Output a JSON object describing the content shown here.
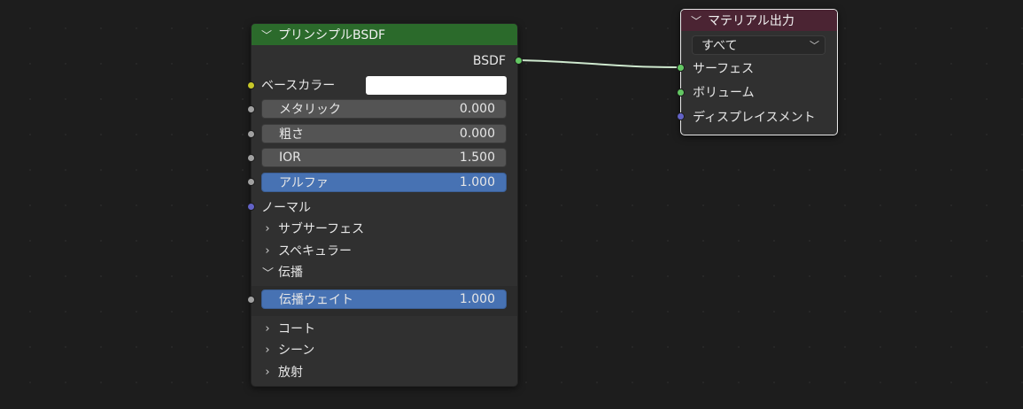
{
  "bsdf_node": {
    "title": "プリンシプルBSDF",
    "output_socket": "BSDF",
    "base_color_label": "ベースカラー",
    "base_color_value": "#ffffff",
    "fields": [
      {
        "label": "メタリック",
        "value": "0.000"
      },
      {
        "label": "粗さ",
        "value": "0.000"
      },
      {
        "label": "IOR",
        "value": "1.500"
      },
      {
        "label": "アルファ",
        "value": "1.000"
      }
    ],
    "normal_label": "ノーマル",
    "panels": {
      "subsurface": "サブサーフェス",
      "specular": "スペキュラー",
      "transmission": "伝播",
      "coat": "コート",
      "sheen": "シーン",
      "emission": "放射"
    },
    "transmission_weight": {
      "label": "伝播ウェイト",
      "value": "1.000"
    }
  },
  "output_node": {
    "title": "マテリアル出力",
    "target": "すべて",
    "inputs": [
      "サーフェス",
      "ボリューム",
      "ディスプレイスメント"
    ]
  },
  "colors": {
    "bsdf_header": "#2b6a2b",
    "output_header": "#4b2433",
    "field_active": "#4772b3",
    "field_default": "#545454",
    "socket_shader": "#63c763",
    "socket_color": "#c7c729",
    "socket_vector": "#6363c7",
    "socket_float": "#a1a1a1",
    "link": "#cfe9cf"
  },
  "icons": {
    "expanded": "chevron-down-icon",
    "collapsed": "chevron-right-icon",
    "dropdown": "chevron-down-icon"
  }
}
